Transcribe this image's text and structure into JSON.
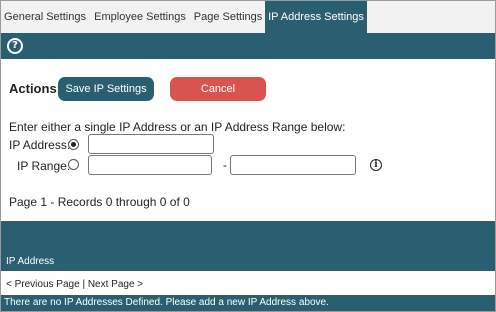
{
  "tabs": [
    {
      "label": "General Settings"
    },
    {
      "label": "Employee Settings"
    },
    {
      "label": "Page Settings"
    },
    {
      "label": "IP Address Settings"
    }
  ],
  "help_icon": "question-circle-icon",
  "actions": {
    "label": "Actions:",
    "save_label": "Save IP Settings",
    "cancel_label": "Cancel"
  },
  "form": {
    "instruction": "Enter either a single IP Address or an IP Address Range below:",
    "ip_address_label": "IP Address:",
    "ip_range_label": "IP Range:",
    "ip_address_value": "",
    "range_start_value": "",
    "range_end_value": "",
    "range_separator": "-",
    "selected_mode": "IP Address",
    "info_icon": "info-icon"
  },
  "records_text": "Page 1 - Records 0 through 0 of 0",
  "table": {
    "column_header": "IP Address",
    "prev_label": "< Previous Page",
    "pager_sep": " | ",
    "next_label": "Next Page >",
    "empty_message": "There are no IP Addresses Defined. Please add a new IP Address above."
  },
  "colors": {
    "accent": "#2a5f72",
    "cancel": "#d9534f"
  }
}
